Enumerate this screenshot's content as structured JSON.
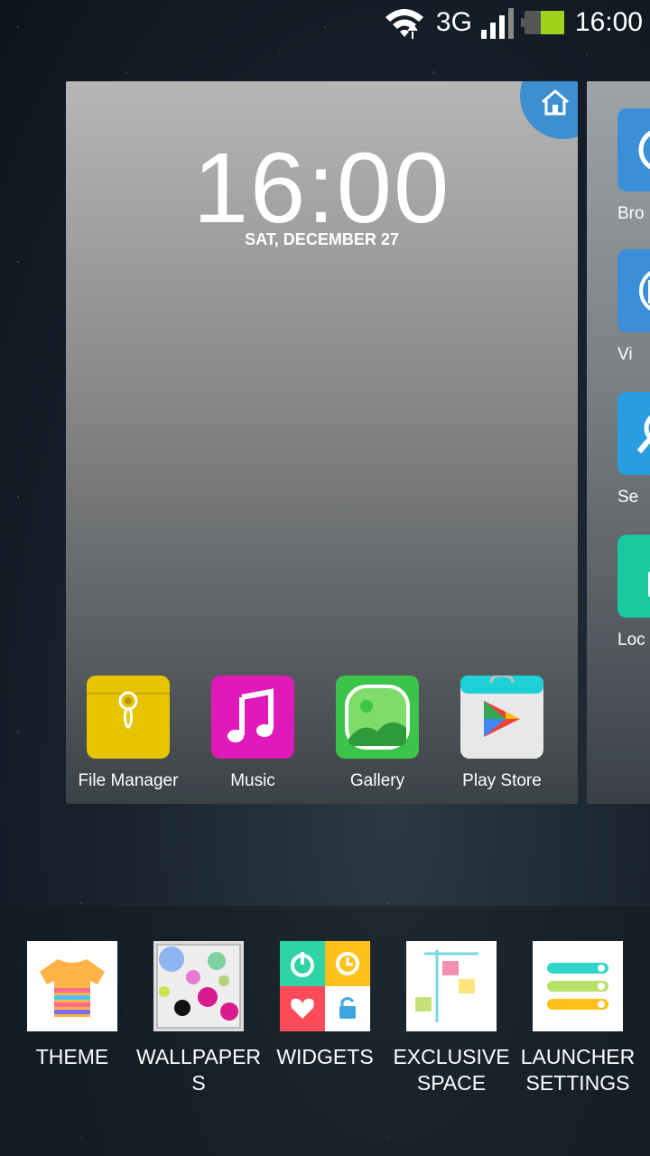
{
  "status_bar": {
    "network": "3G",
    "time": "16:00",
    "icons": [
      "wifi-icon",
      "signal-icon",
      "battery-icon"
    ]
  },
  "page": {
    "clock": "16:00",
    "date": "SAT, DECEMBER 27",
    "home_icon": "home-icon",
    "apps": [
      {
        "label": "File Manager",
        "icon": "file-manager-icon",
        "color": "#e6c400"
      },
      {
        "label": "Music",
        "icon": "music-icon",
        "color": "#e01ab8"
      },
      {
        "label": "Gallery",
        "icon": "gallery-icon",
        "color": "#3cc44a"
      },
      {
        "label": "Play Store",
        "icon": "play-store-icon",
        "color": "#e8e8e8"
      }
    ]
  },
  "side_page": {
    "apps": [
      {
        "label": "Bro",
        "icon": "browser-icon"
      },
      {
        "label": "Vi",
        "icon": "video-icon"
      },
      {
        "label": "Se",
        "icon": "search-icon"
      },
      {
        "label": "Loc",
        "icon": "lock-icon"
      }
    ]
  },
  "menu": {
    "items": [
      {
        "label": "THEME",
        "icon": "tshirt-icon"
      },
      {
        "label": "WALLPAPERS",
        "icon": "wallpaper-icon"
      },
      {
        "label": "WIDGETS",
        "icon": "widgets-icon"
      },
      {
        "label": "EXCLUSIVE SPACE",
        "icon": "exclusive-space-icon"
      },
      {
        "label": "LAUNCHER SETTINGS",
        "icon": "launcher-settings-icon"
      }
    ]
  }
}
